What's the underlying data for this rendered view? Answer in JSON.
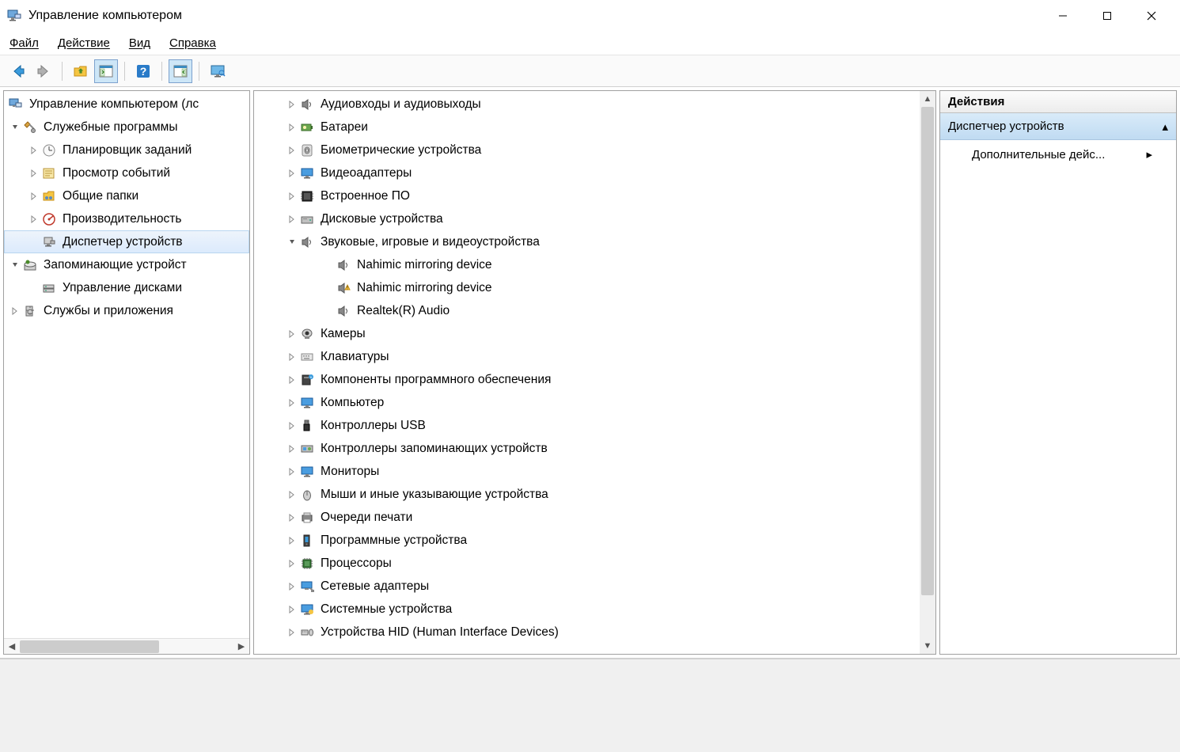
{
  "window": {
    "title": "Управление компьютером"
  },
  "menubar": {
    "file": "Файл",
    "action": "Действие",
    "view": "Вид",
    "help": "Справка"
  },
  "nav_tree": {
    "root": "Управление компьютером (лс",
    "system_tools": "Служебные программы",
    "task_scheduler": "Планировщик заданий",
    "event_viewer": "Просмотр событий",
    "shared_folders": "Общие папки",
    "performance": "Производительность",
    "device_manager": "Диспетчер устройств",
    "storage": "Запоминающие устройст",
    "disk_management": "Управление дисками",
    "services_apps": "Службы и приложения"
  },
  "device_tree": {
    "audio_io": "Аудиовходы и аудиовыходы",
    "batteries": "Батареи",
    "biometric": "Биометрические устройства",
    "display_adapters": "Видеоадаптеры",
    "firmware": "Встроенное ПО",
    "disk_drives": "Дисковые устройства",
    "sound_game_video": "Звуковые, игровые и видеоустройства",
    "nahimic1": "Nahimic mirroring device",
    "nahimic2": "Nahimic mirroring device",
    "realtek": "Realtek(R) Audio",
    "cameras": "Камеры",
    "keyboards": "Клавиатуры",
    "software_components": "Компоненты программного обеспечения",
    "computer": "Компьютер",
    "usb_controllers": "Контроллеры USB",
    "storage_controllers": "Контроллеры запоминающих устройств",
    "monitors": "Мониторы",
    "mice": "Мыши и иные указывающие устройства",
    "print_queues": "Очереди печати",
    "software_devices": "Программные устройства",
    "processors": "Процессоры",
    "network_adapters": "Сетевые адаптеры",
    "system_devices": "Системные устройства",
    "hid": "Устройства HID (Human Interface Devices)"
  },
  "actions": {
    "header": "Действия",
    "subheader": "Диспетчер устройств",
    "more": "Дополнительные дейс..."
  }
}
